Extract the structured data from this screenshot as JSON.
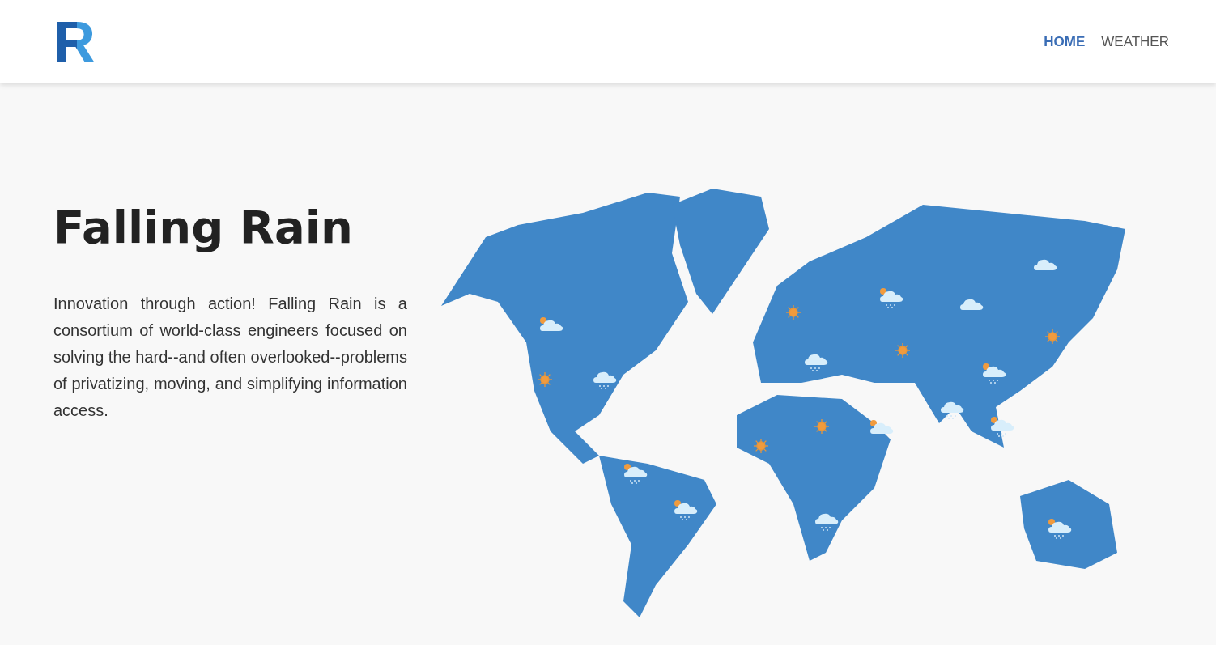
{
  "header": {
    "logo": "R",
    "nav": [
      {
        "label": "HOME",
        "selected": true
      },
      {
        "label": "WEATHER",
        "selected": false
      }
    ]
  },
  "hero": {
    "title": "Falling Rain",
    "text": "Innovation through action! Falling Rain is a consortium of world-class engineers focused on solving the hard--and often overlooked--problems of privatizing, moving, and simplifying information access."
  }
}
